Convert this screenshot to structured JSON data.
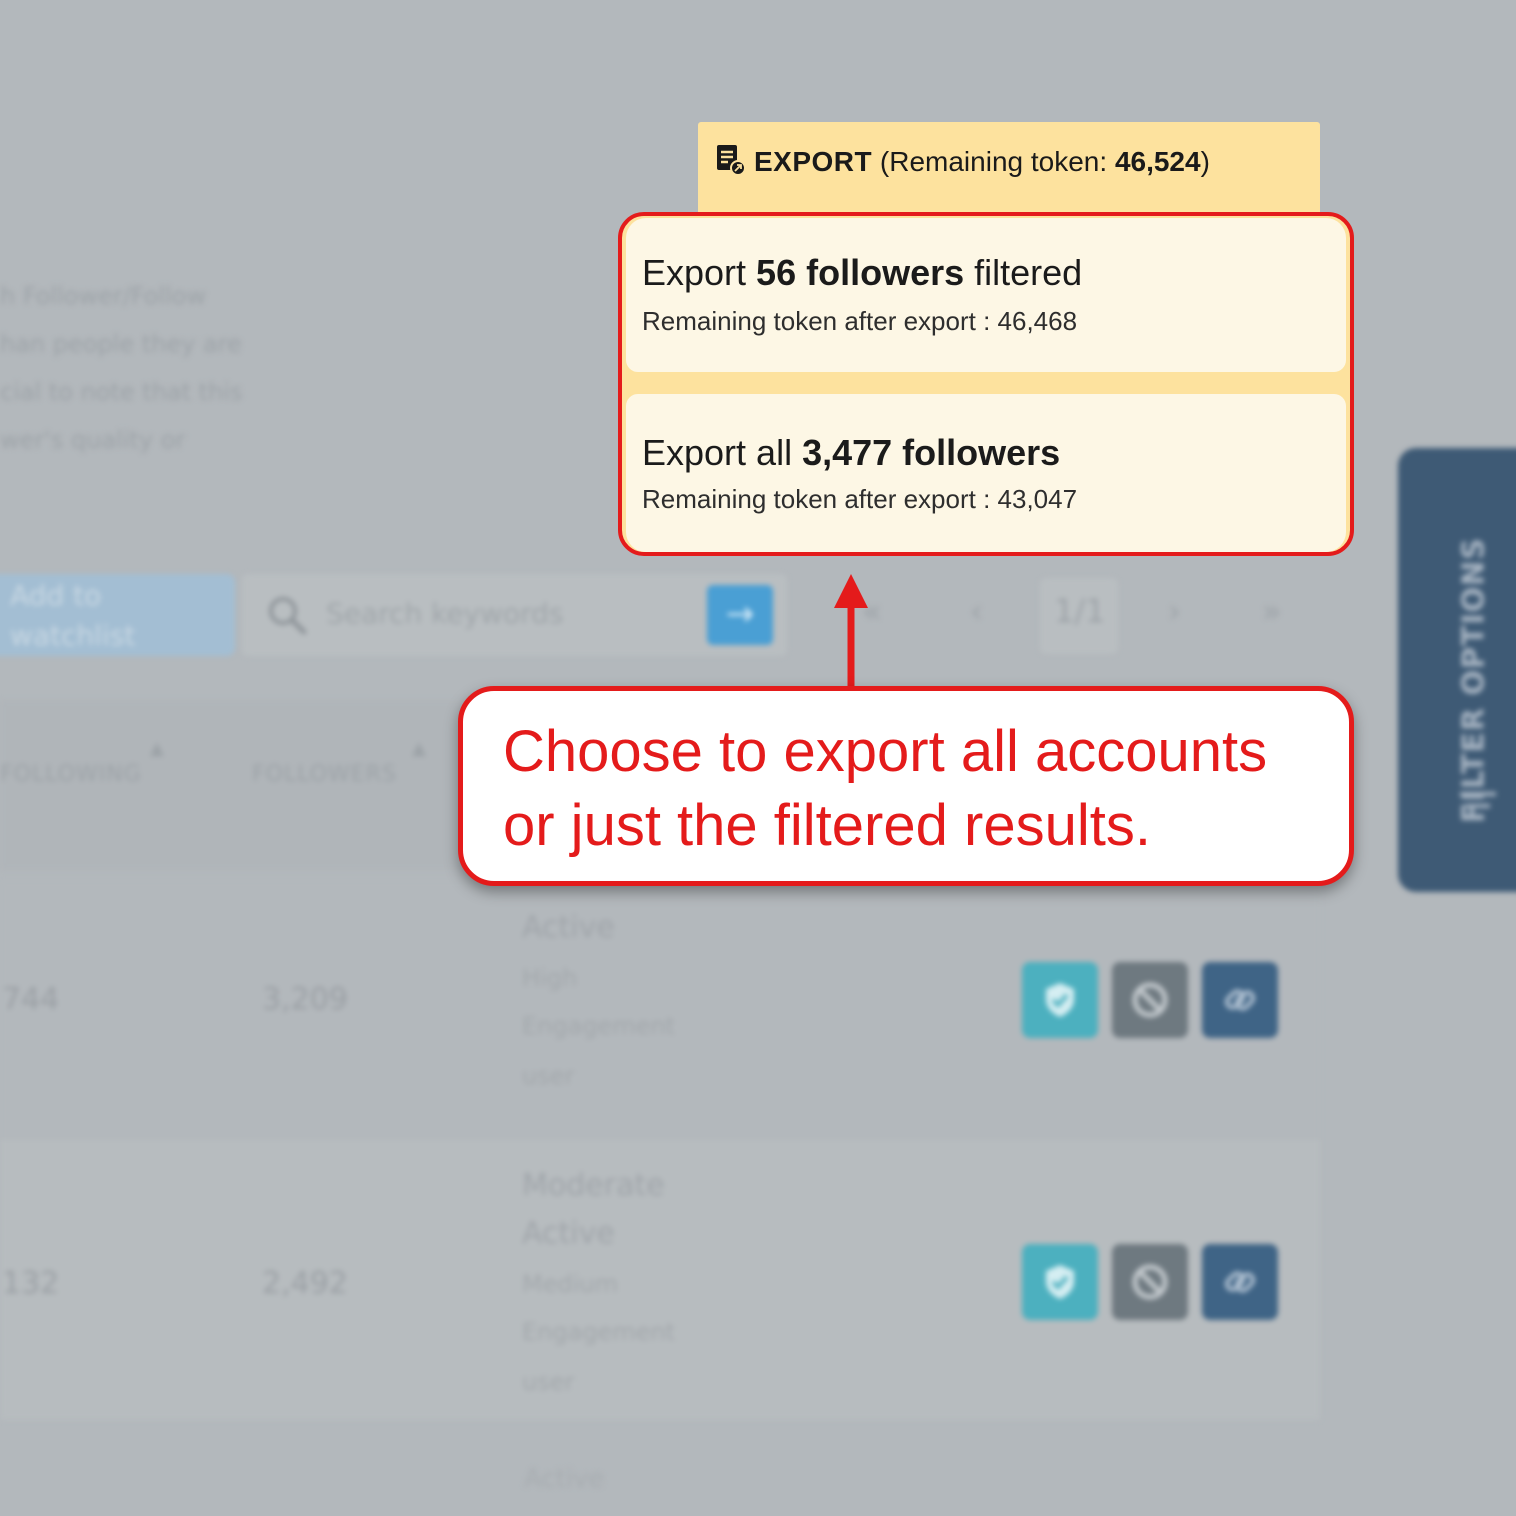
{
  "background": {
    "description_lines": [
      "h Follower/Follow",
      "han people they are",
      "cial to note that this",
      "wer's quality or"
    ],
    "add_to_watchlist_label": "Add to watchlist",
    "search_placeholder": "Search keywords",
    "search_go_glyph": "→",
    "pagination": {
      "first": "«",
      "prev": "‹",
      "page": "1/1",
      "next": "›",
      "last": "»"
    },
    "columns": [
      "FOLLOWING",
      "FOLLOWERS"
    ],
    "rows": [
      {
        "following": "744",
        "followers": "3,209",
        "status": "Active",
        "engagement": [
          "High",
          "Engagement",
          "user"
        ]
      },
      {
        "following": "132",
        "followers": "2,492",
        "status_lines": [
          "Moderate",
          "Active"
        ],
        "engagement": [
          "Medium",
          "Engagement",
          "user"
        ]
      }
    ],
    "bottom_status": "Active",
    "filter_tab_label": "FILTER OPTIONS"
  },
  "export": {
    "title": "EXPORT",
    "remaining_prefix": "(Remaining token: ",
    "remaining_value": "46,524",
    "remaining_suffix": ")",
    "option_filtered": {
      "prefix": "Export ",
      "bold": "56 followers",
      "suffix": " filtered",
      "remaining": "Remaining token after export : 46,468"
    },
    "option_all": {
      "prefix": "Export all ",
      "bold": "3,477 followers",
      "remaining": "Remaining token after export : 43,047"
    }
  },
  "annotation": {
    "text": "Choose to export all accounts or just the filtered results."
  },
  "colors": {
    "accent_red": "#e41b1b",
    "export_yellow": "#fde29e",
    "option_cream": "#fdf7e5",
    "filter_tab": "#3e5a75"
  },
  "icons": [
    "document-export-icon",
    "search-icon",
    "arrow-right-icon",
    "shield-check-icon",
    "ban-icon",
    "link-icon",
    "filter-icon"
  ]
}
